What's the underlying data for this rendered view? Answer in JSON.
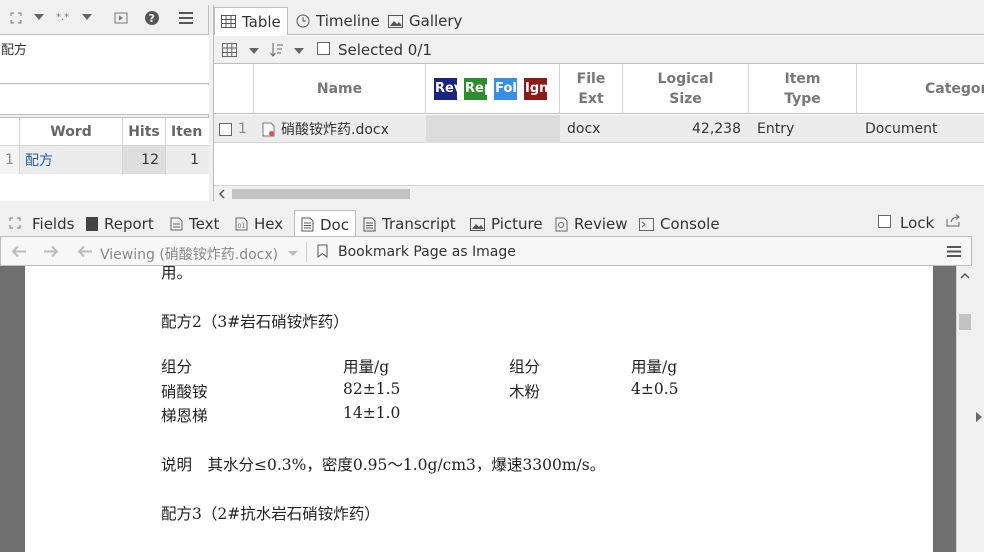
{
  "left_panel": {
    "search_term": "配方",
    "word_table": {
      "headers": [
        "Word",
        "Hits",
        "Iten"
      ],
      "rows": [
        {
          "num": "1",
          "word": "配方",
          "hits": "12",
          "items": "1"
        }
      ]
    }
  },
  "view_tabs": [
    {
      "label": "Table",
      "icon": "table-icon"
    },
    {
      "label": "Timeline",
      "icon": "clock-icon"
    },
    {
      "label": "Gallery",
      "icon": "picture-icon"
    }
  ],
  "table_toolbar": {
    "selected_label": "Selected 0/1"
  },
  "grid": {
    "headers": {
      "name": "Name",
      "tags": [
        "Rev",
        "Rep",
        "Fol",
        "Ign"
      ],
      "file_ext_1": "File",
      "file_ext_2": "Ext",
      "logical_size_1": "Logical",
      "logical_size_2": "Size",
      "item_type_1": "Item",
      "item_type_2": "Type",
      "category": "Categor"
    },
    "rows": [
      {
        "num": "1",
        "name": "硝酸铵炸药.docx",
        "ext": "docx",
        "size": "42,238",
        "type": "Entry",
        "category": "Document"
      }
    ]
  },
  "tag_colors": {
    "rev": "#1a237e",
    "rep": "#2e8b2e",
    "fol": "#3a8ee6",
    "ign": "#8b1a1a"
  },
  "bottom_tabs": [
    {
      "label": "Fields",
      "icon": "fields-icon"
    },
    {
      "label": "Report",
      "icon": "report-icon"
    },
    {
      "label": "Text",
      "icon": "text-icon"
    },
    {
      "label": "Hex",
      "icon": "hex-icon"
    },
    {
      "label": "Doc",
      "icon": "doc-icon"
    },
    {
      "label": "Transcript",
      "icon": "transcript-icon"
    },
    {
      "label": "Picture",
      "icon": "picture-icon"
    },
    {
      "label": "Review",
      "icon": "review-icon"
    },
    {
      "label": "Console",
      "icon": "console-icon"
    }
  ],
  "lock_label": "Lock",
  "doc_toolbar": {
    "viewing_label": "Viewing (硝酸铵炸药.docx)",
    "bookmark_label": "Bookmark Page as Image"
  },
  "document": {
    "line_top": "用。",
    "formula2_title": "配方2（3#岩石硝铵炸药）",
    "col_component": "组分",
    "col_amount": "用量/g",
    "col_component2": "组分",
    "col_amount2": "用量/g",
    "row1_c1": "硝酸铵",
    "row1_v1": "82±1.5",
    "row1_c2": "木粉",
    "row1_v2": "4±0.5",
    "row2_c1": "梯恩梯",
    "row2_v1": "14±1.0",
    "note": "说明　其水分≤0.3%，密度0.95～1.0g/cm3，爆速3300m/s。",
    "formula3_title": "配方3（2#抗水岩石硝铵炸药）"
  }
}
